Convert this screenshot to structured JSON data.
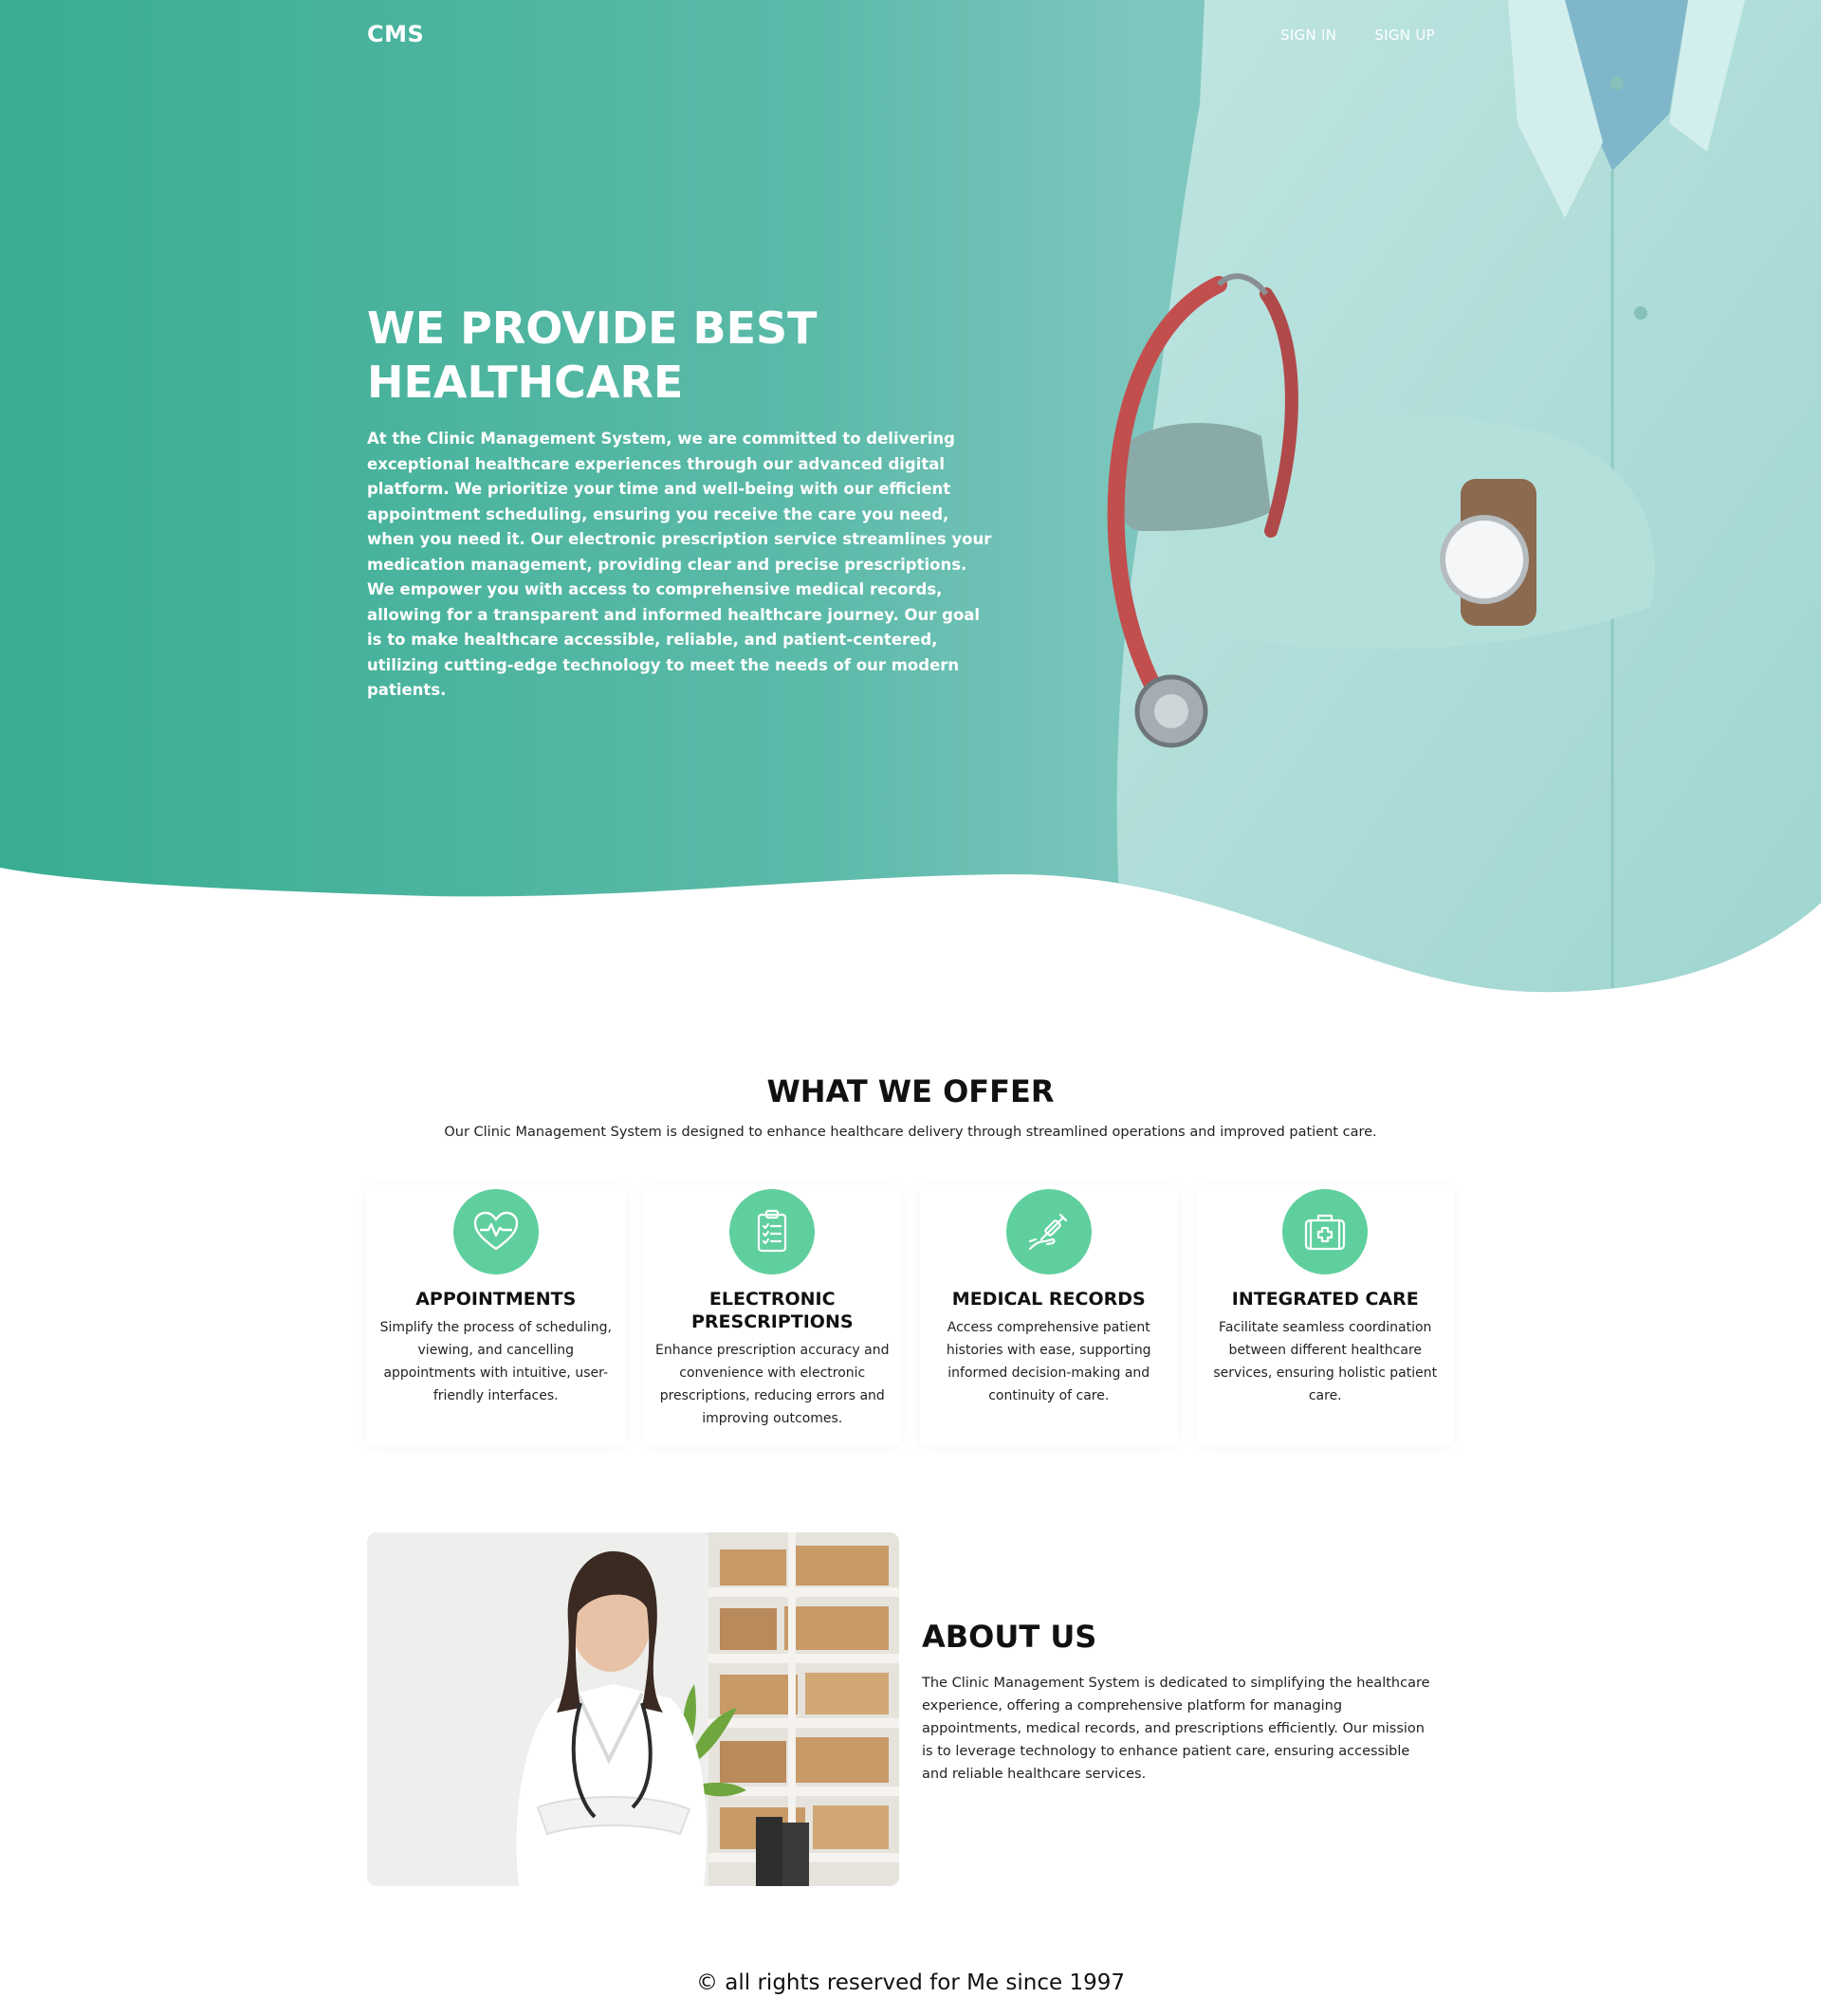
{
  "nav": {
    "logo": "CMS",
    "sign_in": "SIGN IN",
    "sign_up": "SIGN UP"
  },
  "hero": {
    "title": "WE PROVIDE BEST HEALTHCARE",
    "text": "At the Clinic Management System, we are committed to delivering exceptional healthcare experiences through our advanced digital platform. We prioritize your time and well-being with our efficient appointment scheduling, ensuring you receive the care you need, when you need it. Our electronic prescription service streamlines your medication management, providing clear and precise prescriptions. We empower you with access to comprehensive medical records, allowing for a transparent and informed healthcare journey. Our goal is to make healthcare accessible, reliable, and patient-centered, utilizing cutting-edge technology to meet the needs of our modern patients."
  },
  "offer": {
    "title": "WHAT WE OFFER",
    "subtitle": "Our Clinic Management System is designed to enhance healthcare delivery through streamlined operations and improved patient care.",
    "cards": [
      {
        "icon": "heart-pulse-icon",
        "title": "APPOINTMENTS",
        "text": "Simplify the process of scheduling, viewing, and cancelling appointments with intuitive, user-friendly interfaces."
      },
      {
        "icon": "clipboard-checklist-icon",
        "title": "ELECTRONIC PRESCRIPTIONS",
        "text": "Enhance prescription accuracy and convenience with electronic prescriptions, reducing errors and improving outcomes."
      },
      {
        "icon": "hand-syringe-icon",
        "title": "MEDICAL RECORDS",
        "text": "Access comprehensive patient histories with ease, supporting informed decision-making and continuity of care."
      },
      {
        "icon": "first-aid-kit-icon",
        "title": "INTEGRATED CARE",
        "text": "Facilitate seamless coordination between different healthcare services, ensuring holistic patient care."
      }
    ]
  },
  "about": {
    "title": "ABOUT US",
    "text": "The Clinic Management System is dedicated to simplifying the healthcare experience, offering a comprehensive platform for managing appointments, medical records, and prescriptions efficiently. Our mission is to leverage technology to enhance patient care, ensuring accessible and reliable healthcare services."
  },
  "footer": {
    "text": "© all rights reserved for Me since 1997"
  },
  "colors": {
    "hero_teal": "#3fb39a",
    "icon_green": "#5fcf9e",
    "coat_light": "#a9dad6"
  }
}
